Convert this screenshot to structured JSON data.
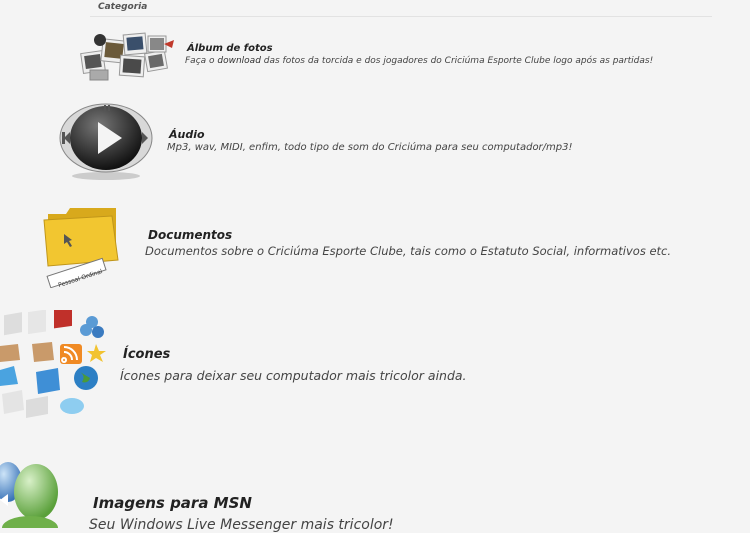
{
  "header": {
    "label": "Categoria"
  },
  "categories": [
    {
      "title": "Álbum de fotos",
      "desc_before": "Faça o ",
      "desc_em": "download",
      "desc_after": " das fotos da torcida e dos jogadores do Criciúma Esporte Clube logo após as partidas!"
    },
    {
      "title": "Áudio",
      "desc": "Mp3, wav, MIDI, enfim, todo tipo de som do Criciúma para seu computador/mp3!"
    },
    {
      "title": "Documentos",
      "desc": "Documentos sobre o Criciúma Esporte Clube, tais como o Estatuto Social, informativos etc."
    },
    {
      "title": "Ícones",
      "desc": "Ícones para deixar seu computador mais tricolor ainda."
    },
    {
      "title": "Imagens para MSN",
      "desc": "Seu Windows Live Messenger mais tricolor!"
    }
  ],
  "icons": {
    "folder_label": "Pessoal Ordinal"
  }
}
